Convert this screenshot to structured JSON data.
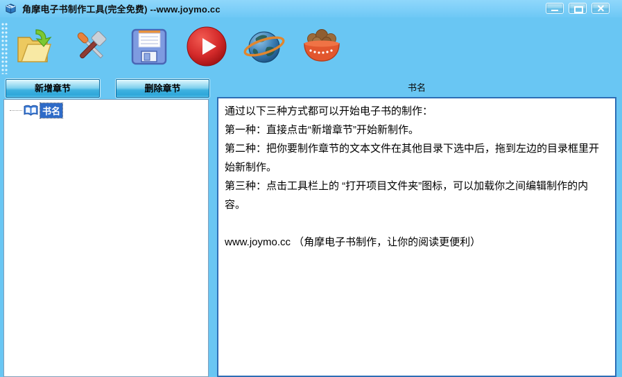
{
  "window": {
    "title": "角摩电子书制作工具(完全免费) --www.joymo.cc"
  },
  "toolbar": {
    "icon_names": [
      "open-folder",
      "tools",
      "save-floppy",
      "play",
      "globe",
      "snack-bowl"
    ]
  },
  "chapter_bar": {
    "add_button": "新增章节",
    "delete_button": "删除章节",
    "book_title_header": "书名"
  },
  "tree": {
    "root_item": "书名"
  },
  "content": {
    "lines": [
      "通过以下三种方式都可以开始电子书的制作：",
      "第一种：直接点击“新增章节”开始新制作。",
      "第二种：把你要制作章节的文本文件在其他目录下选中后，拖到左边的目录框里开始新制作。",
      "第三种：点击工具栏上的 “打开项目文件夹”图标，可以加载你之间编辑制作的内容。",
      "",
      "www.joymo.cc （角摩电子书制作，让你的阅读更便利）"
    ]
  },
  "colors": {
    "background": "#69C6F3",
    "titlebar": "#82D1FA",
    "selection_blue": "#2E6BC8",
    "panel_border_dark": "#2D6DB5",
    "panel_border_light": "#7F9DB9",
    "button_border": "#0A6CA3"
  }
}
